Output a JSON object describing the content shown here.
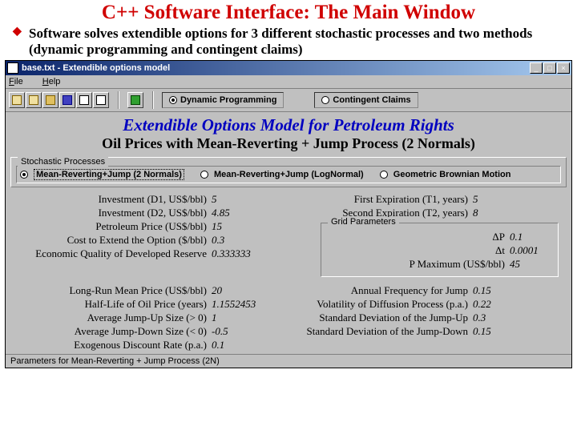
{
  "slide": {
    "title": "C++ Software Interface: The Main Window",
    "subtitle": "Software solves extendible options for 3 different stochastic processes and two methods (dynamic programming and contingent claims)"
  },
  "window": {
    "title": "base.txt - Extendible options model",
    "min_label": "_",
    "max_label": "□",
    "close_label": "×"
  },
  "menu": {
    "file": "File",
    "help": "Help"
  },
  "toolbar": {
    "method_a": "Dynamic Programming",
    "method_b": "Contingent Claims"
  },
  "headings": {
    "blue": "Extendible Options Model for Petroleum Rights",
    "black": "Oil Prices with Mean-Reverting + Jump Process (2 Normals)"
  },
  "stochastic": {
    "legend": "Stochastic Processes",
    "opt1": "Mean-Reverting+Jump (2 Normals)",
    "opt2": "Mean-Reverting+Jump (LogNormal)",
    "opt3": "Geometric Brownian Motion"
  },
  "params_left": [
    {
      "label": "Investment (D1, US$/bbl)",
      "value": "5"
    },
    {
      "label": "Investment (D2, US$/bbl)",
      "value": "4.85"
    },
    {
      "label": "Petroleum Price (US$/bbl)",
      "value": "15"
    },
    {
      "label": "Cost to Extend the Option ($/bbl)",
      "value": "0.3"
    },
    {
      "label": "Economic Quality of Developed Reserve",
      "value": "0.333333"
    }
  ],
  "params_right": [
    {
      "label": "First Expiration  (T1, years)",
      "value": "5"
    },
    {
      "label": "Second Expiration (T2, years)",
      "value": "8"
    }
  ],
  "grid": {
    "legend": "Grid Parameters",
    "rows": [
      {
        "label": "ΔP",
        "value": "0.1"
      },
      {
        "label": "Δt",
        "value": "0.0001"
      },
      {
        "label": "P Maximum (US$/bbl)",
        "value": "45"
      }
    ]
  },
  "params_left2": [
    {
      "label": "Long-Run Mean Price (US$/bbl)",
      "value": "20"
    },
    {
      "label": "Half-Life of Oil Price (years)",
      "value": "1.1552453"
    },
    {
      "label": "Average Jump-Up Size (> 0)",
      "value": "1"
    },
    {
      "label": "Average Jump-Down Size (< 0)",
      "value": "-0.5"
    },
    {
      "label": "Exogenous Discount Rate (p.a.)",
      "value": "0.1"
    }
  ],
  "params_right2": [
    {
      "label": "Annual Frequency for Jump",
      "value": "0.15"
    },
    {
      "label": "Volatility of Diffusion Process (p.a.)",
      "value": "0.22"
    },
    {
      "label": "Standard Deviation of the Jump-Up",
      "value": "0.3"
    },
    {
      "label": "Standard Deviation of the Jump-Down",
      "value": "0.15"
    }
  ],
  "status": "Parameters for Mean-Reverting + Jump Process (2N)"
}
